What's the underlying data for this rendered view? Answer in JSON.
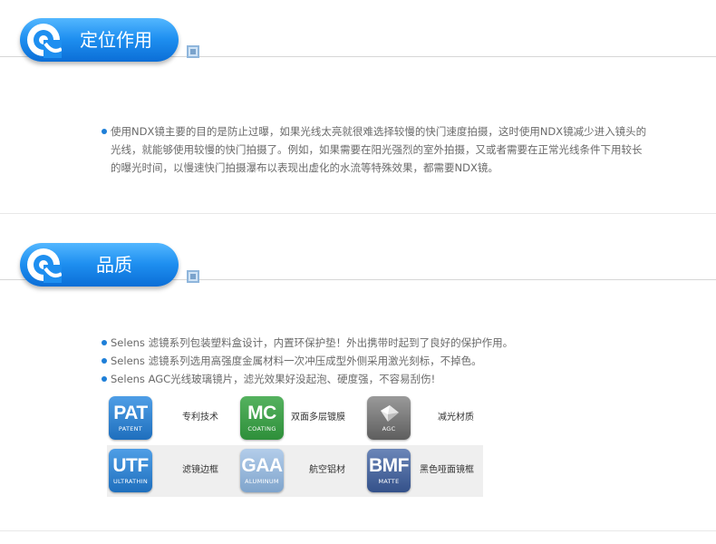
{
  "sections": [
    {
      "title": "定位作用"
    },
    {
      "title": "品质"
    }
  ],
  "positioning": {
    "lines": [
      "使用NDX镜主要的目的是防止过曝，如果光线太亮就很难选择较慢的快门速度拍摄，这时使用NDX镜减少进入镜头的",
      "光线，就能够使用较慢的快门拍摄了。例如，如果需要在阳光强烈的室外拍摄，又或者需要在正常光线条件下用较长",
      "的曝光时间，以慢速快门拍摄瀑布以表现出虚化的水流等特殊效果，都需要NDX镜。"
    ]
  },
  "quality": {
    "bullets": [
      "Selens 滤镜系列包装塑料盒设计，内置环保护垫！外出携带时起到了良好的保护作用。",
      "Selens 滤镜系列选用高强度金属材料一次冲压成型外侧采用激光刻标，不掉色。",
      "Selens AGC光线玻璃镜片，滤光效果好没起泡、硬度强，不容易刮伤!"
    ],
    "features": [
      {
        "big": "PAT",
        "small": "PATENT",
        "label": "专利技术",
        "color": "#1f6fbd",
        "icon": "pat-icon"
      },
      {
        "big": "MC",
        "small": "COATING",
        "label": "双面多层镀膜",
        "color": "#2e8f3a",
        "icon": "mc-icon"
      },
      {
        "big": "",
        "small": "AGC",
        "label": "减光材质",
        "color": "#707070",
        "icon": "agc-icon"
      },
      {
        "big": "UTF",
        "small": "ULTRATHIN",
        "label": "滤镜边框",
        "color": "#1f6fbd",
        "icon": "utf-icon"
      },
      {
        "big": "GAA",
        "small": "ALUMINUM",
        "label": "航空铝材",
        "color": "#7fa4cc",
        "icon": "gaa-icon"
      },
      {
        "big": "BMF",
        "small": "MATTE",
        "label": "黑色哑面镜框",
        "color": "#34518a",
        "icon": "bmf-icon"
      }
    ]
  }
}
